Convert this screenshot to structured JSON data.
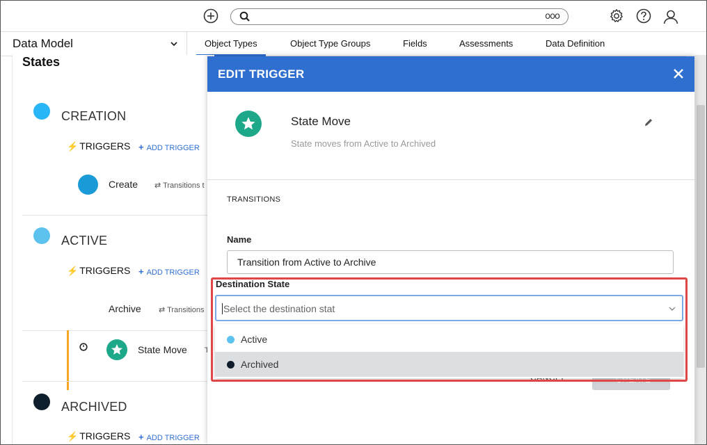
{
  "topbar": {
    "add_icon": "plus-circle-icon",
    "search": {
      "icon": "search-icon",
      "value": "",
      "more_label": "ooo"
    },
    "settings_icon": "gear-icon",
    "help_icon": "help-circle-icon",
    "profile_icon": "user-icon"
  },
  "nav": {
    "selector_label": "Data Model",
    "tabs": [
      {
        "label": "Object Types",
        "active": true
      },
      {
        "label": "Object Type Groups",
        "active": false
      },
      {
        "label": "Fields",
        "active": false
      },
      {
        "label": "Assessments",
        "active": false
      },
      {
        "label": "Data Definition",
        "active": false
      }
    ]
  },
  "left": {
    "title": "States",
    "states": [
      {
        "name": "CREATION",
        "color": "#29b6f6",
        "triggers_label": "TRIGGERS",
        "add_trigger_label": "ADD TRIGGER",
        "items": [
          {
            "label": "Create",
            "transition": "Transitions t",
            "color": "#1a9bd7"
          }
        ]
      },
      {
        "name": "ACTIVE",
        "color": "#5ec2ef",
        "triggers_label": "TRIGGERS",
        "add_trigger_label": "ADD TRIGGER",
        "items": [
          {
            "label": "Archive",
            "transition": "Transitions"
          },
          {
            "label": "State Move",
            "transition": "T",
            "color": "#1ea88a"
          }
        ]
      },
      {
        "name": "ARCHIVED",
        "color": "#0f1e2c",
        "triggers_label": "TRIGGERS",
        "add_trigger_label": "ADD TRIGGER"
      }
    ]
  },
  "modal": {
    "title": "EDIT TRIGGER",
    "close_icon": "close-icon",
    "trigger_icon": "star-icon",
    "trigger_name": "State Move",
    "trigger_description": "State moves from Active to Archived",
    "edit_icon": "pencil-icon",
    "section_title": "TRANSITIONS",
    "name_label": "Name",
    "name_value": "Transition from Active to Archive",
    "destination_label": "Destination State",
    "destination_placeholder": "Select the destination stat",
    "options": [
      {
        "label": "Active",
        "color": "#5ec2ef"
      },
      {
        "label": "Archived",
        "color": "#0f1e2c",
        "highlighted": true
      }
    ],
    "cancel_label": "CANCEL",
    "create_label": "CREATE"
  },
  "colors": {
    "accent": "#2f6fd0",
    "highlight_border": "#e04646",
    "left_accent_bar": "#f5a623"
  }
}
